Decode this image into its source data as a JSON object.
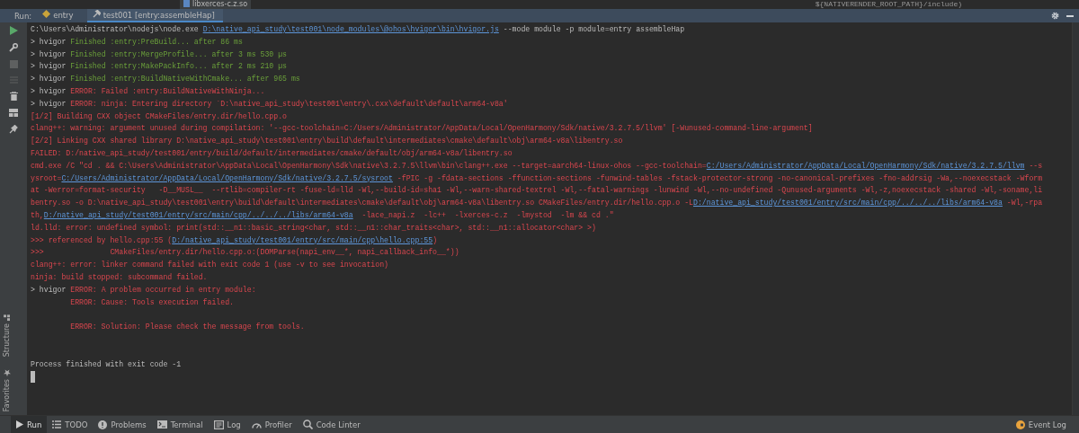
{
  "editor_strip": {
    "file_tab": "libxerces-c.z.so",
    "code_fragment": "${NATIVERENDER_ROOT_PATH}/include)"
  },
  "run_panel": {
    "label": "Run:",
    "tabs": [
      {
        "label": "entry",
        "selected": false
      },
      {
        "label": "test001 [entry:assembleHap]",
        "selected": true
      }
    ]
  },
  "console": {
    "lines": [
      {
        "kind": "text",
        "segments": [
          {
            "kind": "plain",
            "text": "C:\\Users\\Administrator\\nodejs\\node.exe "
          },
          {
            "kind": "link",
            "text": "D:\\native_api_study\\test001\\node_modules\\@ohos\\hvigor\\bin\\hvigor.js"
          },
          {
            "kind": "plain",
            "text": " --mode module -p module=entry assembleHap"
          }
        ]
      },
      {
        "kind": "text",
        "segments": [
          {
            "kind": "plain",
            "text": "> hvigor "
          },
          {
            "kind": "green",
            "text": "Finished :entry:PreBuild... after 86 ms"
          }
        ]
      },
      {
        "kind": "text",
        "segments": [
          {
            "kind": "plain",
            "text": "> hvigor "
          },
          {
            "kind": "green",
            "text": "Finished :entry:MergeProfile... after 3 ms 530 µs"
          }
        ]
      },
      {
        "kind": "text",
        "segments": [
          {
            "kind": "plain",
            "text": "> hvigor "
          },
          {
            "kind": "green",
            "text": "Finished :entry:MakePackInfo... after 2 ms 210 µs"
          }
        ]
      },
      {
        "kind": "text",
        "segments": [
          {
            "kind": "plain",
            "text": "> hvigor "
          },
          {
            "kind": "green",
            "text": "Finished :entry:BuildNativeWithCmake... after 965 ms"
          }
        ]
      },
      {
        "kind": "text",
        "segments": [
          {
            "kind": "plain",
            "text": "> hvigor "
          },
          {
            "kind": "red",
            "text": "ERROR: Failed :entry:BuildNativeWithNinja..."
          }
        ]
      },
      {
        "kind": "text",
        "segments": [
          {
            "kind": "plain",
            "text": "> hvigor "
          },
          {
            "kind": "red",
            "text": "ERROR: ninja: Entering directory `D:\\native_api_study\\test001\\entry\\.cxx\\default\\default\\arm64-v8a'"
          }
        ]
      },
      {
        "kind": "text",
        "segments": [
          {
            "kind": "red",
            "text": "[1/2] Building CXX object CMakeFiles/entry.dir/hello.cpp.o"
          }
        ]
      },
      {
        "kind": "text",
        "segments": [
          {
            "kind": "red",
            "text": "clang++: warning: argument unused during compilation: '--gcc-toolchain=C:/Users/Administrator/AppData/Local/OpenHarmony/Sdk/native/3.2.7.5/llvm' [-Wunused-command-line-argument]"
          }
        ]
      },
      {
        "kind": "text",
        "segments": [
          {
            "kind": "red",
            "text": "[2/2] Linking CXX shared library D:\\native_api_study\\test001\\entry\\build\\default\\intermediates\\cmake\\default\\obj\\arm64-v8a\\libentry.so"
          }
        ]
      },
      {
        "kind": "text",
        "segments": [
          {
            "kind": "red",
            "text": "FAILED: D:/native_api_study/test001/entry/build/default/intermediates/cmake/default/obj/arm64-v8a/libentry.so"
          }
        ]
      },
      {
        "kind": "text",
        "segments": [
          {
            "kind": "red",
            "text": "cmd.exe /C \"cd . && C:\\Users\\Administrator\\AppData\\Local\\OpenHarmony\\Sdk\\native\\3.2.7.5\\llvm\\bin\\clang++.exe --target=aarch64-linux-ohos --gcc-toolchain="
          },
          {
            "kind": "link",
            "text": "C:/Users/Administrator/AppData/Local/OpenHarmony/Sdk/native/3.2.7.5/llvm"
          },
          {
            "kind": "red",
            "text": " --s"
          }
        ]
      },
      {
        "kind": "text",
        "segments": [
          {
            "kind": "red",
            "text": "ysroot="
          },
          {
            "kind": "link",
            "text": "C:/Users/Administrator/AppData/Local/OpenHarmony/Sdk/native/3.2.7.5/sysroot"
          },
          {
            "kind": "red",
            "text": " -fPIC -g -fdata-sections -ffunction-sections -funwind-tables -fstack-protector-strong -no-canonical-prefixes -fno-addrsig -Wa,--noexecstack -Wform"
          }
        ]
      },
      {
        "kind": "text",
        "segments": [
          {
            "kind": "red",
            "text": "at -Werror=format-security   -D__MUSL__  --rtlib=compiler-rt -fuse-ld=lld -Wl,--build-id=sha1 -Wl,--warn-shared-textrel -Wl,--fatal-warnings -lunwind -Wl,--no-undefined -Qunused-arguments -Wl,-z,noexecstack -shared -Wl,-soname,li"
          }
        ]
      },
      {
        "kind": "text",
        "segments": [
          {
            "kind": "red",
            "text": "bentry.so -o D:\\native_api_study\\test001\\entry\\build\\default\\intermediates\\cmake\\default\\obj\\arm64-v8a\\libentry.so CMakeFiles/entry.dir/hello.cpp.o -L"
          },
          {
            "kind": "link",
            "text": "D:/native_api_study/test001/entry/src/main/cpp/../../../libs/arm64-v8a"
          },
          {
            "kind": "red",
            "text": " -Wl,-rpa"
          }
        ]
      },
      {
        "kind": "text",
        "segments": [
          {
            "kind": "red",
            "text": "th,"
          },
          {
            "kind": "link",
            "text": "D:/native_api_study/test001/entry/src/main/cpp/../../../libs/arm64-v8a"
          },
          {
            "kind": "red",
            "text": "  -lace_napi.z  -lc++  -lxerces-c.z  -lmystod  -lm && cd .\""
          }
        ]
      },
      {
        "kind": "text",
        "segments": [
          {
            "kind": "red",
            "text": "ld.lld: error: undefined symbol: print(std::__n1::basic_string<char, std::__n1::char_traits<char>, std::__n1::allocator<char> >)"
          }
        ]
      },
      {
        "kind": "text",
        "segments": [
          {
            "kind": "red",
            "text": ">>> referenced by hello.cpp:55 ("
          },
          {
            "kind": "link",
            "text": "D:/native_api_study/test001/entry/src/main/cpp\\hello.cpp:55"
          },
          {
            "kind": "red",
            "text": ")"
          }
        ]
      },
      {
        "kind": "text",
        "segments": [
          {
            "kind": "red",
            "text": ">>>               CMakeFiles/entry.dir/hello.cpp.o:(DOMParse(napi_env__*, napi_callback_info__*))"
          }
        ]
      },
      {
        "kind": "text",
        "segments": [
          {
            "kind": "red",
            "text": "clang++: error: linker command failed with exit code 1 (use -v to see invocation)"
          }
        ]
      },
      {
        "kind": "text",
        "segments": [
          {
            "kind": "red",
            "text": "ninja: build stopped: subcommand failed."
          }
        ]
      },
      {
        "kind": "text",
        "segments": [
          {
            "kind": "plain",
            "text": "> hvigor "
          },
          {
            "kind": "red",
            "text": "ERROR: A problem occurred in entry module:"
          }
        ]
      },
      {
        "kind": "text",
        "segments": [
          {
            "kind": "red",
            "text": "         ERROR: Cause: Tools execution failed."
          }
        ]
      },
      {
        "kind": "blank"
      },
      {
        "kind": "text",
        "segments": [
          {
            "kind": "red",
            "text": "         ERROR: Solution: Please check the message from tools."
          }
        ]
      },
      {
        "kind": "blank"
      },
      {
        "kind": "blank"
      },
      {
        "kind": "text",
        "segments": [
          {
            "kind": "plain",
            "text": "Process finished with exit code -1"
          }
        ]
      },
      {
        "kind": "cursor"
      }
    ]
  },
  "side_labels": [
    "Structure",
    "Favorites"
  ],
  "bottom_bar": {
    "tabs": [
      {
        "label": "Run",
        "selected": true
      },
      {
        "label": "TODO",
        "selected": false
      },
      {
        "label": "Problems",
        "selected": false
      },
      {
        "label": "Terminal",
        "selected": false
      },
      {
        "label": "Log",
        "selected": false
      },
      {
        "label": "Profiler",
        "selected": false
      },
      {
        "label": "Code Linter",
        "selected": false
      }
    ],
    "event_log": "Event Log"
  }
}
